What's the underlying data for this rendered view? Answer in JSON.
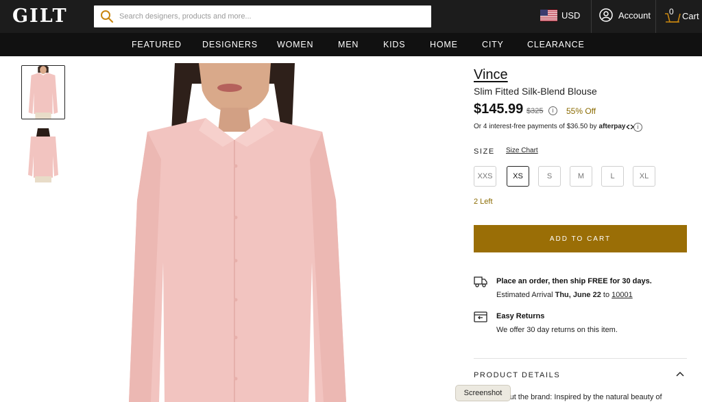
{
  "header": {
    "logo": "GILT",
    "search_placeholder": "Search designers, products and more...",
    "currency": "USD",
    "account": "Account",
    "cart_label": "Cart",
    "cart_count": "0"
  },
  "nav": {
    "items": [
      "FEATURED",
      "DESIGNERS",
      "WOMEN",
      "MEN",
      "KIDS",
      "HOME",
      "CITY",
      "CLEARANCE"
    ]
  },
  "product": {
    "brand": "Vince",
    "name": "Slim Fitted Silk-Blend Blouse",
    "price": "$145.99",
    "old_price": "$325",
    "discount": "55% Off",
    "afterpay_text": "Or 4 interest-free payments of $36.50 by",
    "afterpay_brand": "afterpay",
    "size_label": "SIZE",
    "size_chart": "Size Chart",
    "sizes": [
      "XXS",
      "XS",
      "S",
      "M",
      "L",
      "XL"
    ],
    "selected_size": "XS",
    "stock": "2 Left",
    "add_to_cart": "ADD TO CART",
    "colors": {
      "accent": "#9a6e06",
      "discount": "#8a6a00",
      "shirt": "#f2c4c0"
    }
  },
  "shipping": {
    "headline": "Place an order, then ship FREE for 30 days.",
    "arrival_prefix": "Estimated Arrival",
    "arrival_date": "Thu, June 22",
    "arrival_to": "to",
    "zip": "10001"
  },
  "returns": {
    "headline": "Easy Returns",
    "sub": "We offer 30 day returns on this item."
  },
  "details": {
    "heading": "PRODUCT DETAILS",
    "text": "About the brand: Inspired by the natural beauty of"
  },
  "overlay": {
    "tooltip": "Screenshot"
  }
}
